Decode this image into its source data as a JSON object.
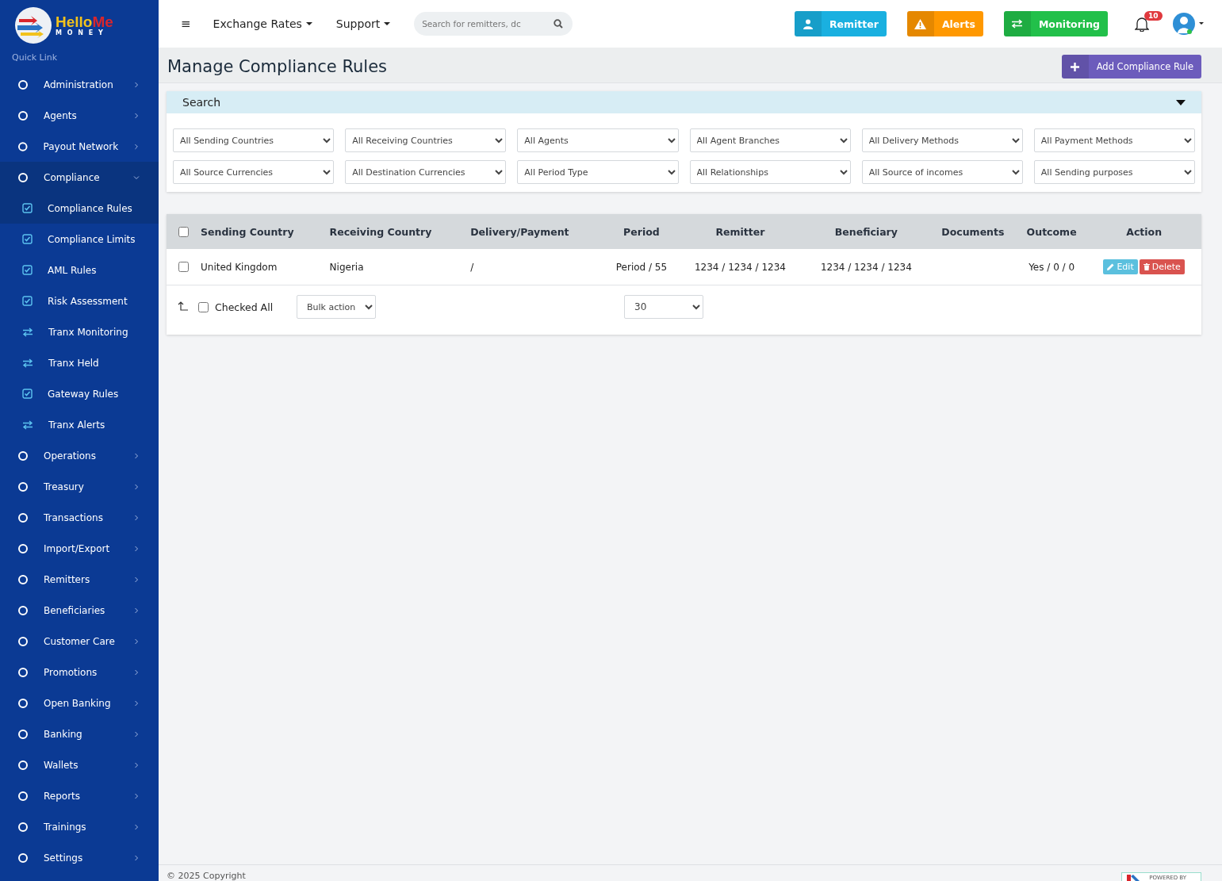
{
  "logo": {
    "name": "Hello",
    "name_accent": "Me",
    "sub": "M O N E Y"
  },
  "sidebar": {
    "heading": "Quick Link",
    "items": [
      {
        "label": "Administration",
        "expanded": false,
        "selected": false
      },
      {
        "label": "Agents",
        "expanded": false,
        "selected": false
      },
      {
        "label": "Payout Network",
        "expanded": false,
        "selected": false
      },
      {
        "label": "Compliance",
        "expanded": true,
        "selected": true,
        "children": [
          {
            "label": "Compliance Rules",
            "kind": "check",
            "selected": true
          },
          {
            "label": "Compliance Limits",
            "kind": "check",
            "selected": false
          },
          {
            "label": "AML Rules",
            "kind": "check",
            "selected": false
          },
          {
            "label": "Risk Assessment",
            "kind": "check",
            "selected": false
          },
          {
            "label": "Tranx Monitoring",
            "kind": "arrows",
            "selected": false
          },
          {
            "label": "Tranx Held",
            "kind": "arrows",
            "selected": false
          },
          {
            "label": "Gateway Rules",
            "kind": "check",
            "selected": false
          },
          {
            "label": "Tranx Alerts",
            "kind": "arrows",
            "selected": false
          }
        ]
      },
      {
        "label": "Operations",
        "expanded": false,
        "selected": false
      },
      {
        "label": "Treasury",
        "expanded": false,
        "selected": false
      },
      {
        "label": "Transactions",
        "expanded": false,
        "selected": false
      },
      {
        "label": "Import/Export",
        "expanded": false,
        "selected": false
      },
      {
        "label": "Remitters",
        "expanded": false,
        "selected": false
      },
      {
        "label": "Beneficiaries",
        "expanded": false,
        "selected": false
      },
      {
        "label": "Customer Care",
        "expanded": false,
        "selected": false
      },
      {
        "label": "Promotions",
        "expanded": false,
        "selected": false
      },
      {
        "label": "Open Banking",
        "expanded": false,
        "selected": false
      },
      {
        "label": "Banking",
        "expanded": false,
        "selected": false
      },
      {
        "label": "Wallets",
        "expanded": false,
        "selected": false
      },
      {
        "label": "Reports",
        "expanded": false,
        "selected": false
      },
      {
        "label": "Trainings",
        "expanded": false,
        "selected": false
      },
      {
        "label": "Settings",
        "expanded": false,
        "selected": false
      }
    ]
  },
  "topbar": {
    "menu_glyph": "≡",
    "menus": [
      "Exchange Rates",
      "Support"
    ],
    "search": {
      "placeholder": "Search for remitters, dc"
    },
    "buttons": [
      {
        "label": "Remitter",
        "color": "#1ab0e0"
      },
      {
        "label": "Alerts",
        "color": "#ff9800"
      },
      {
        "label": "Monitoring",
        "color": "#22c04a"
      }
    ],
    "notifications": "10"
  },
  "page": {
    "title": "Manage Compliance Rules",
    "add_button": "Add Compliance Rule"
  },
  "search_panel": {
    "title": "Search",
    "expanded": true,
    "filters": [
      "All Sending Countries",
      "All Receiving Countries",
      "All Agents",
      "All Agent Branches",
      "All Delivery Methods",
      "All Payment Methods",
      "All Source Currencies",
      "All Destination Currencies",
      "All Period Type",
      "All Relationships",
      "All Source of incomes",
      "All Sending purposes"
    ]
  },
  "table": {
    "columns": [
      "Sending Country",
      "Receiving Country",
      "Delivery/Payment",
      "Period",
      "Remitter",
      "Beneficiary",
      "Documents",
      "Outcome",
      "Action"
    ],
    "header_checked": false,
    "rows": [
      {
        "checked": false,
        "cells": [
          "United Kingdom",
          "Nigeria",
          "/",
          "Period / 55",
          "1234 / 1234 / 1234",
          "1234 / 1234 / 1234"
        ],
        "outcome": "Yes / 0 / 0",
        "edit": "Edit",
        "delete": "Delete"
      }
    ],
    "check_all": {
      "label": "Checked All",
      "checked": false
    },
    "bulk_action": "Bulk action",
    "page_size": "30"
  },
  "footer": {
    "copyright": "© 2025 Copyright",
    "powered": "POWERED BY"
  }
}
